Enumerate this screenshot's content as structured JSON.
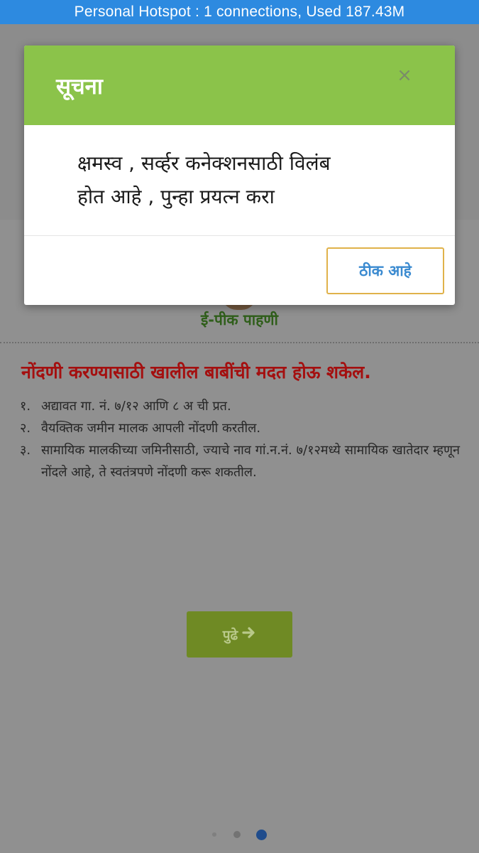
{
  "status_bar": {
    "text": "Personal Hotspot : 1 connections, Used 187.43M"
  },
  "app": {
    "logo_caption": "ई-पीक पाहणी",
    "help_title": "नोंदणी करण्यासाठी खालील बाबींची मदत होऊ शकेल.",
    "help_items": [
      {
        "num": "१.",
        "text": "अद्यावत गा. नं. ७/१२ आणि ८ अ ची प्रत."
      },
      {
        "num": "२.",
        "text": "वैयक्तिक जमीन मालक आपली नोंदणी करतील."
      },
      {
        "num": "३.",
        "text": "सामायिक मालकीच्या जमिनीसाठी, ज्याचे नाव गां.न.नं. ७/१२मध्ये सामायिक खातेदार म्हणून नोंदले आहे, ते स्वतंत्रपणे नोंदणी करू शकतील."
      }
    ],
    "next_label": "पुढे",
    "next_icon": "arrow-right-icon",
    "pager": {
      "total": 3,
      "active": 3
    }
  },
  "dialog": {
    "title": "सूचना",
    "close_label": "×",
    "message_line1": "क्षमस्व , सर्व्हर कनेक्शनसाठी विलंब",
    "message_line2": "होत आहे , पुन्हा प्रयत्न करा",
    "ok_label": "ठीक आहे"
  },
  "colors": {
    "status_bar": "#2d8ae0",
    "dialog_header": "#8bc34a",
    "ok_border": "#e0b24a",
    "ok_text": "#3a8ad0",
    "help_title": "#a40f0f",
    "next_button": "#6f8a24",
    "pager_active": "#1f4c8c"
  }
}
